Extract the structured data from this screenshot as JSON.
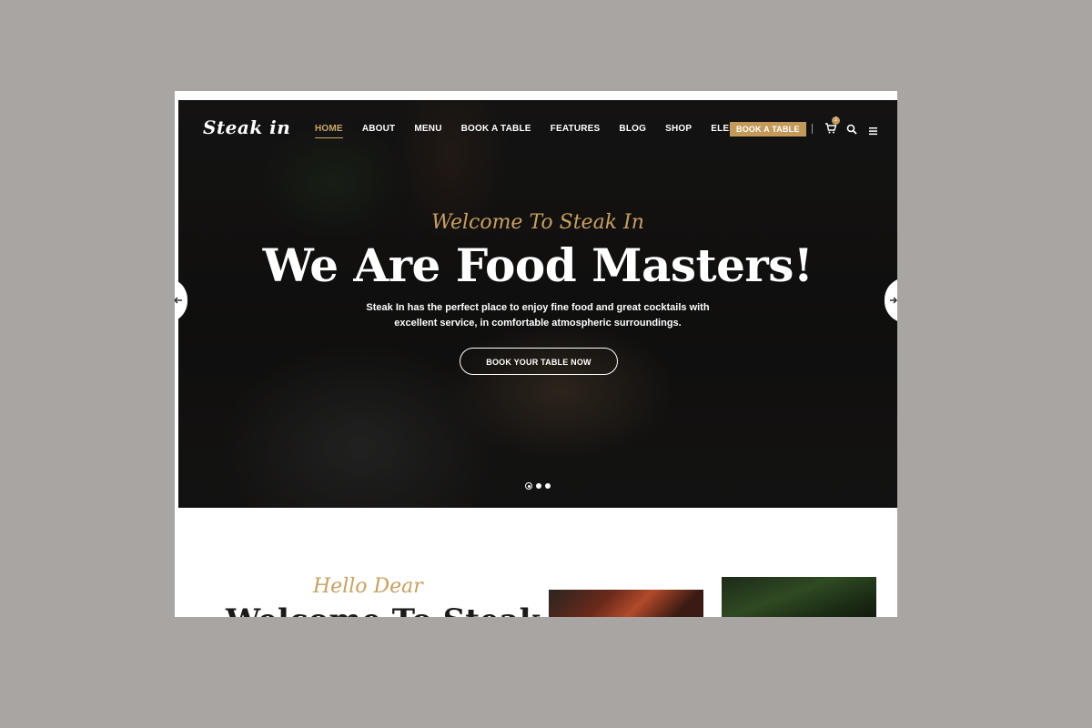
{
  "header": {
    "logo": "Steak in",
    "nav": [
      "HOME",
      "ABOUT",
      "MENU",
      "BOOK A TABLE",
      "FEATURES",
      "BLOG",
      "SHOP",
      "ELEMENTS"
    ],
    "active_nav": "HOME",
    "book_button": "BOOK A TABLE",
    "cart_count": "2"
  },
  "hero": {
    "welcome": "Welcome To Steak In",
    "headline": "We Are Food Masters!",
    "description": "Steak In has the perfect place to enjoy fine food and great cocktails with excellent service, in comfortable atmospheric surroundings.",
    "cta": "BOOK YOUR TABLE NOW"
  },
  "intro": {
    "script_heading": "Hello Dear",
    "title": "Welcome To Steak In"
  },
  "colors": {
    "accent": "#c9a05e",
    "button": "#c49a5a"
  }
}
